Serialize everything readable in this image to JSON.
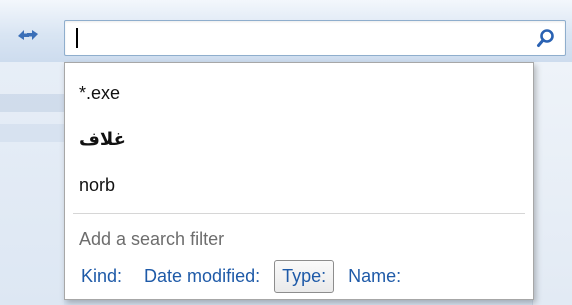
{
  "search": {
    "value": "",
    "history": [
      "*.exe",
      "غلاف",
      "norb"
    ],
    "filter_heading": "Add a search filter",
    "filters": [
      {
        "label": "Kind:",
        "active": false
      },
      {
        "label": "Date modified:",
        "active": false
      },
      {
        "label": "Type:",
        "active": true
      },
      {
        "label": "Name:",
        "active": false
      }
    ]
  },
  "icons": {
    "refresh": "refresh-arrows-icon",
    "search": "magnifier-icon"
  },
  "colors": {
    "filter_link": "#1e5aa8",
    "heading_gray": "#6d6d6d",
    "icon_blue": "#2a62b3"
  }
}
